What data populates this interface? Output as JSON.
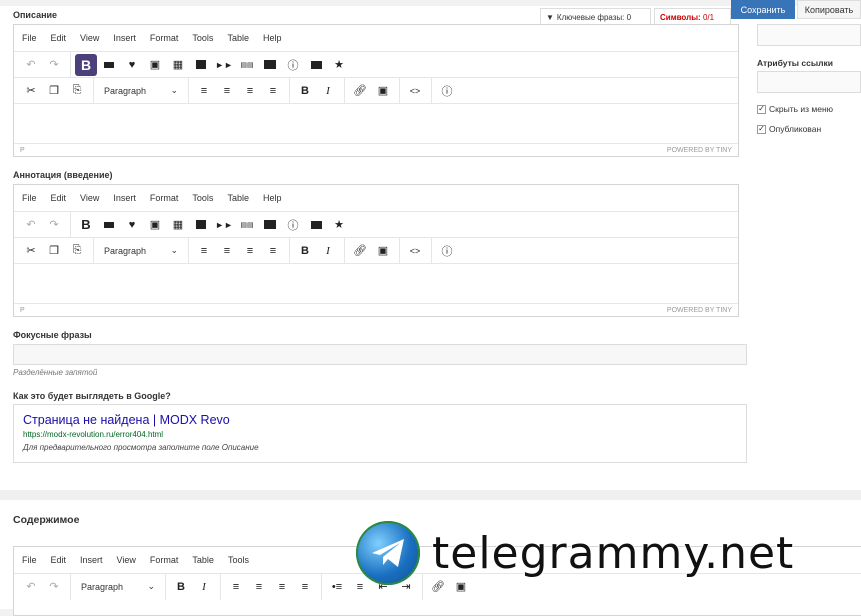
{
  "header": {
    "tab_keywords_label": "Ключевые фразы:",
    "tab_keywords_count": "0",
    "tab_symbols_label": "Символы:",
    "tab_symbols_count": "0/1",
    "save_label": "Сохранить",
    "copy_label": "Копировать"
  },
  "menu": [
    "File",
    "Edit",
    "View",
    "Insert",
    "Format",
    "Tools",
    "Table",
    "Help"
  ],
  "menu2": [
    "File",
    "Edit",
    "Insert",
    "View",
    "Format",
    "Table",
    "Tools"
  ],
  "paragraph_label": "Paragraph",
  "status_path": "P",
  "powered": "POWERED BY TINY",
  "description": {
    "label": "Описание"
  },
  "annotation": {
    "label": "Аннотация (введение)"
  },
  "focus": {
    "label": "Фокусные фразы",
    "hint": "Разделённые запятой"
  },
  "preview": {
    "label": "Как это будет выглядеть в Google?",
    "title": "Страница не найдена | MODX Revo",
    "url": "https://modx-revolution.ru/error404.html",
    "desc": "Для предварительного просмотра заполните поле Описание"
  },
  "content": {
    "label": "Содержимое"
  },
  "sidebar": {
    "link_attrs_label": "Атрибуты ссылки",
    "hide_menu_label": "Скрыть из меню",
    "published_label": "Опубликован"
  },
  "watermark": "telegrammy.net"
}
